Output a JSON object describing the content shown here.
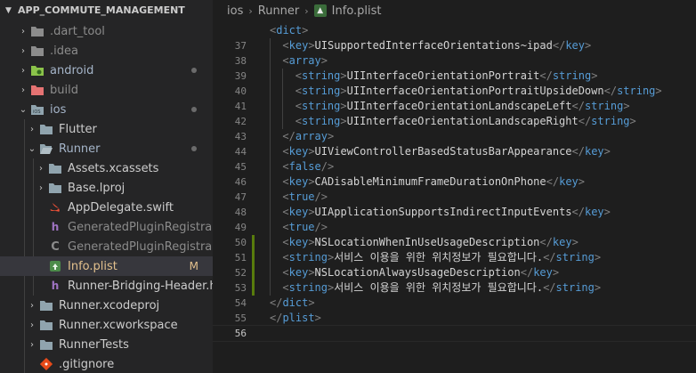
{
  "explorer": {
    "title": "APP_COMMUTE_MANAGEMENT",
    "items": [
      {
        "label": "dart_tool_label",
        "text": ".dart_tool"
      },
      {
        "text": ".idea"
      },
      {
        "text": "android"
      },
      {
        "text": "build"
      },
      {
        "text": "ios"
      },
      {
        "text": "Flutter"
      },
      {
        "text": "Runner"
      },
      {
        "text": "Assets.xcassets"
      },
      {
        "text": "Base.lproj"
      },
      {
        "text": "AppDelegate.swift"
      },
      {
        "text": "GeneratedPluginRegistrant.h"
      },
      {
        "text": "GeneratedPluginRegistrant.m"
      },
      {
        "text": "Info.plist",
        "badge": "M"
      },
      {
        "text": "Runner-Bridging-Header.h"
      },
      {
        "text": "Runner.xcodeproj"
      },
      {
        "text": "Runner.xcworkspace"
      },
      {
        "text": "RunnerTests"
      },
      {
        "text": ".gitignore"
      }
    ]
  },
  "breadcrumb": [
    "ios",
    "Runner",
    "Info.plist"
  ],
  "code": {
    "lines": [
      {
        "n": "",
        "indent": 0,
        "parts": [
          {
            "k": "br",
            "t": "<"
          },
          {
            "k": "tag",
            "t": "dict"
          },
          {
            "k": "br",
            "t": ">"
          }
        ]
      },
      {
        "n": "37",
        "indent": 1,
        "parts": [
          {
            "k": "br",
            "t": "<"
          },
          {
            "k": "tag",
            "t": "key"
          },
          {
            "k": "br",
            "t": ">"
          },
          {
            "k": "tx",
            "t": "UISupportedInterfaceOrientations~ipad"
          },
          {
            "k": "br",
            "t": "</"
          },
          {
            "k": "tag",
            "t": "key"
          },
          {
            "k": "br",
            "t": ">"
          }
        ]
      },
      {
        "n": "38",
        "indent": 1,
        "parts": [
          {
            "k": "br",
            "t": "<"
          },
          {
            "k": "tag",
            "t": "array"
          },
          {
            "k": "br",
            "t": ">"
          }
        ]
      },
      {
        "n": "39",
        "indent": 2,
        "parts": [
          {
            "k": "br",
            "t": "<"
          },
          {
            "k": "tag",
            "t": "string"
          },
          {
            "k": "br",
            "t": ">"
          },
          {
            "k": "tx",
            "t": "UIInterfaceOrientationPortrait"
          },
          {
            "k": "br",
            "t": "</"
          },
          {
            "k": "tag",
            "t": "string"
          },
          {
            "k": "br",
            "t": ">"
          }
        ]
      },
      {
        "n": "40",
        "indent": 2,
        "parts": [
          {
            "k": "br",
            "t": "<"
          },
          {
            "k": "tag",
            "t": "string"
          },
          {
            "k": "br",
            "t": ">"
          },
          {
            "k": "tx",
            "t": "UIInterfaceOrientationPortraitUpsideDown"
          },
          {
            "k": "br",
            "t": "</"
          },
          {
            "k": "tag",
            "t": "string"
          },
          {
            "k": "br",
            "t": ">"
          }
        ]
      },
      {
        "n": "41",
        "indent": 2,
        "parts": [
          {
            "k": "br",
            "t": "<"
          },
          {
            "k": "tag",
            "t": "string"
          },
          {
            "k": "br",
            "t": ">"
          },
          {
            "k": "tx",
            "t": "UIInterfaceOrientationLandscapeLeft"
          },
          {
            "k": "br",
            "t": "</"
          },
          {
            "k": "tag",
            "t": "string"
          },
          {
            "k": "br",
            "t": ">"
          }
        ]
      },
      {
        "n": "42",
        "indent": 2,
        "parts": [
          {
            "k": "br",
            "t": "<"
          },
          {
            "k": "tag",
            "t": "string"
          },
          {
            "k": "br",
            "t": ">"
          },
          {
            "k": "tx",
            "t": "UIInterfaceOrientationLandscapeRight"
          },
          {
            "k": "br",
            "t": "</"
          },
          {
            "k": "tag",
            "t": "string"
          },
          {
            "k": "br",
            "t": ">"
          }
        ]
      },
      {
        "n": "43",
        "indent": 1,
        "parts": [
          {
            "k": "br",
            "t": "</"
          },
          {
            "k": "tag",
            "t": "array"
          },
          {
            "k": "br",
            "t": ">"
          }
        ]
      },
      {
        "n": "44",
        "indent": 1,
        "parts": [
          {
            "k": "br",
            "t": "<"
          },
          {
            "k": "tag",
            "t": "key"
          },
          {
            "k": "br",
            "t": ">"
          },
          {
            "k": "tx",
            "t": "UIViewControllerBasedStatusBarAppearance"
          },
          {
            "k": "br",
            "t": "</"
          },
          {
            "k": "tag",
            "t": "key"
          },
          {
            "k": "br",
            "t": ">"
          }
        ]
      },
      {
        "n": "45",
        "indent": 1,
        "parts": [
          {
            "k": "br",
            "t": "<"
          },
          {
            "k": "tag",
            "t": "false"
          },
          {
            "k": "br",
            "t": "/>"
          }
        ]
      },
      {
        "n": "46",
        "indent": 1,
        "parts": [
          {
            "k": "br",
            "t": "<"
          },
          {
            "k": "tag",
            "t": "key"
          },
          {
            "k": "br",
            "t": ">"
          },
          {
            "k": "tx",
            "t": "CADisableMinimumFrameDurationOnPhone"
          },
          {
            "k": "br",
            "t": "</"
          },
          {
            "k": "tag",
            "t": "key"
          },
          {
            "k": "br",
            "t": ">"
          }
        ]
      },
      {
        "n": "47",
        "indent": 1,
        "parts": [
          {
            "k": "br",
            "t": "<"
          },
          {
            "k": "tag",
            "t": "true"
          },
          {
            "k": "br",
            "t": "/>"
          }
        ]
      },
      {
        "n": "48",
        "indent": 1,
        "parts": [
          {
            "k": "br",
            "t": "<"
          },
          {
            "k": "tag",
            "t": "key"
          },
          {
            "k": "br",
            "t": ">"
          },
          {
            "k": "tx",
            "t": "UIApplicationSupportsIndirectInputEvents"
          },
          {
            "k": "br",
            "t": "</"
          },
          {
            "k": "tag",
            "t": "key"
          },
          {
            "k": "br",
            "t": ">"
          }
        ]
      },
      {
        "n": "49",
        "indent": 1,
        "parts": [
          {
            "k": "br",
            "t": "<"
          },
          {
            "k": "tag",
            "t": "true"
          },
          {
            "k": "br",
            "t": "/>"
          }
        ]
      },
      {
        "n": "50",
        "indent": 1,
        "git": true,
        "parts": [
          {
            "k": "br",
            "t": "<"
          },
          {
            "k": "tag",
            "t": "key"
          },
          {
            "k": "br",
            "t": ">"
          },
          {
            "k": "tx",
            "t": "NSLocationWhenInUseUsageDescription"
          },
          {
            "k": "br",
            "t": "</"
          },
          {
            "k": "tag",
            "t": "key"
          },
          {
            "k": "br",
            "t": ">"
          }
        ]
      },
      {
        "n": "51",
        "indent": 1,
        "git": true,
        "parts": [
          {
            "k": "br",
            "t": "<"
          },
          {
            "k": "tag",
            "t": "string"
          },
          {
            "k": "br",
            "t": ">"
          },
          {
            "k": "tx",
            "t": "서비스 이용을 위한 위치정보가 필요합니다."
          },
          {
            "k": "br",
            "t": "</"
          },
          {
            "k": "tag",
            "t": "string"
          },
          {
            "k": "br",
            "t": ">"
          }
        ]
      },
      {
        "n": "52",
        "indent": 1,
        "git": true,
        "parts": [
          {
            "k": "br",
            "t": "<"
          },
          {
            "k": "tag",
            "t": "key"
          },
          {
            "k": "br",
            "t": ">"
          },
          {
            "k": "tx",
            "t": "NSLocationAlwaysUsageDescription"
          },
          {
            "k": "br",
            "t": "</"
          },
          {
            "k": "tag",
            "t": "key"
          },
          {
            "k": "br",
            "t": ">"
          }
        ]
      },
      {
        "n": "53",
        "indent": 1,
        "git": true,
        "parts": [
          {
            "k": "br",
            "t": "<"
          },
          {
            "k": "tag",
            "t": "string"
          },
          {
            "k": "br",
            "t": ">"
          },
          {
            "k": "tx",
            "t": "서비스 이용을 위한 위치정보가 필요합니다."
          },
          {
            "k": "br",
            "t": "</"
          },
          {
            "k": "tag",
            "t": "string"
          },
          {
            "k": "br",
            "t": ">"
          }
        ]
      },
      {
        "n": "54",
        "indent": 0,
        "parts": [
          {
            "k": "br",
            "t": "</"
          },
          {
            "k": "tag",
            "t": "dict"
          },
          {
            "k": "br",
            "t": ">"
          }
        ]
      },
      {
        "n": "55",
        "indent": 0,
        "parts": [
          {
            "k": "br",
            "t": "</"
          },
          {
            "k": "tag",
            "t": "plist"
          },
          {
            "k": "br",
            "t": ">"
          }
        ]
      },
      {
        "n": "56",
        "indent": 0,
        "active": true,
        "parts": []
      }
    ]
  },
  "colors": {
    "tag": "#569cd6",
    "bracket": "#808080",
    "text": "#d4d4d4",
    "git_added": "#587c0c",
    "modified": "#e2c08d"
  }
}
